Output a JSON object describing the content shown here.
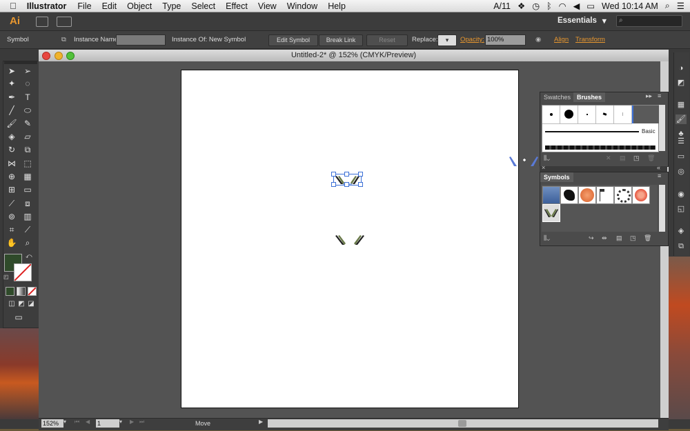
{
  "menubar": {
    "apple_icon": "",
    "app_name": "Illustrator",
    "items": [
      "File",
      "Edit",
      "Object",
      "Type",
      "Select",
      "Effect",
      "View",
      "Window",
      "Help"
    ],
    "status_adobe": "11",
    "clock": "Wed 10:14 AM"
  },
  "appbar": {
    "logo": "Ai",
    "workspace": "Essentials",
    "workspace_caret": "▾"
  },
  "control": {
    "selection_type": "Symbol",
    "instance_name_label": "Instance Name:",
    "instance_of_label": "Instance Of:",
    "instance_of_value": "New Symbol",
    "edit_symbol": "Edit Symbol",
    "break_link": "Break Link",
    "reset": "Reset",
    "replace_label": "Replace:",
    "opacity_label": "Opacity:",
    "opacity_value": "100%",
    "align": "Align",
    "transform": "Transform"
  },
  "document": {
    "title": "Untitled-2* @ 152% (CMYK/Preview)"
  },
  "statusbar": {
    "zoom": "152%",
    "artboard_num": "1",
    "status": "Move"
  },
  "panels": {
    "swatches_tab": "Swatches",
    "brushes_tab": "Brushes",
    "brush_basic_label": "Basic",
    "symbols_tab": "Symbols"
  },
  "colors": {
    "fill": "#2f4a2a",
    "accent": "#e8972f",
    "selection": "#3b6fd6"
  }
}
